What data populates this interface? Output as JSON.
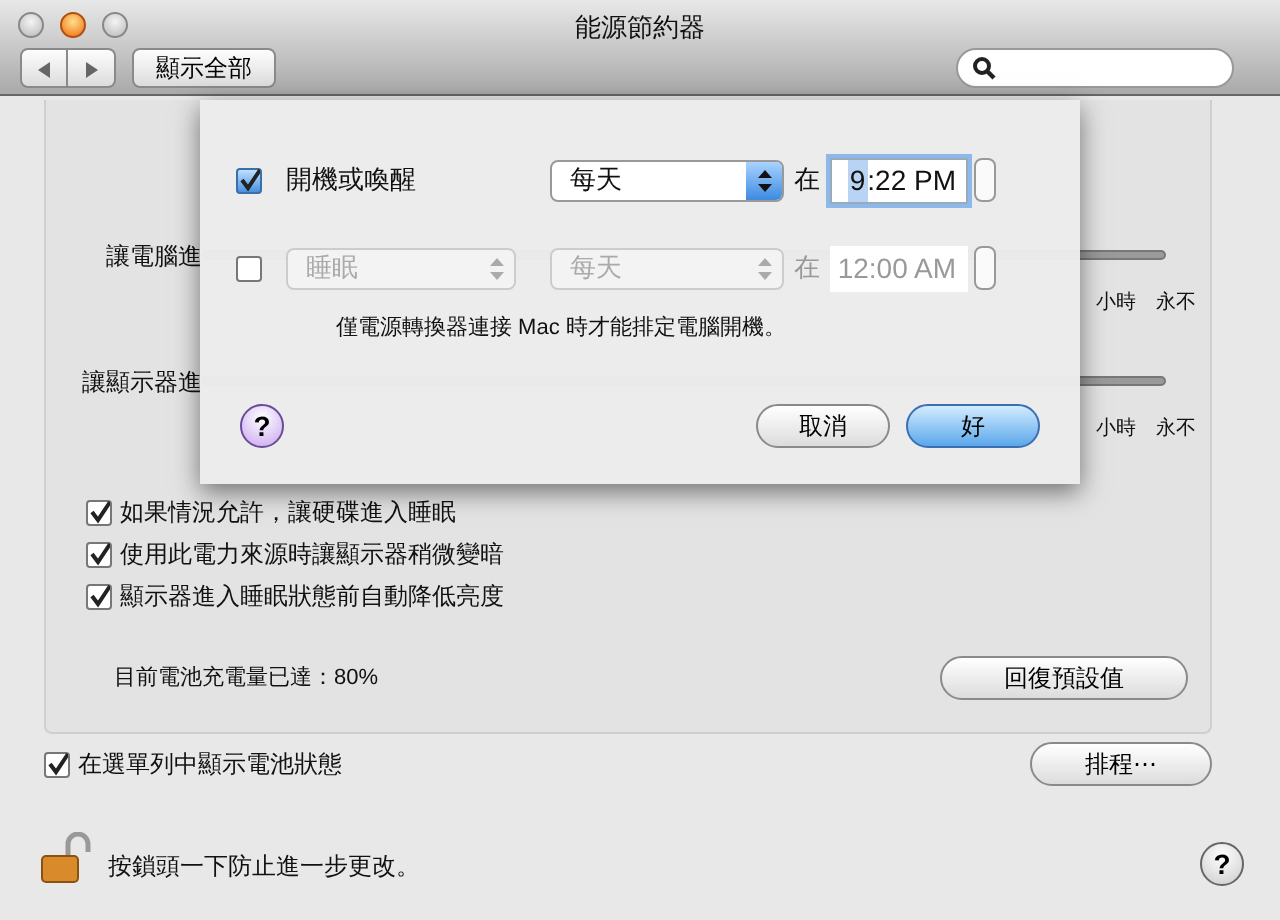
{
  "window": {
    "title": "能源節約器"
  },
  "toolbar": {
    "show_all_button": "顯示全部"
  },
  "settings": {
    "sliders": [
      {
        "label": "讓電腦進",
        "tick_labels": [
          "小時",
          "永不"
        ]
      },
      {
        "label": "讓顯示器進",
        "tick_labels": [
          "小時",
          "永不"
        ]
      }
    ],
    "options": [
      {
        "label": "如果情況允許，讓硬碟進入睡眠",
        "checked": true
      },
      {
        "label": "使用此電力來源時讓顯示器稍微變暗",
        "checked": true
      },
      {
        "label": "顯示器進入睡眠狀態前自動降低亮度",
        "checked": true
      }
    ],
    "battery_status": "目前電池充電量已達：80%",
    "restore_button": "回復預設值"
  },
  "menu_bar_option": {
    "label": "在選單列中顯示電池狀態",
    "checked": true
  },
  "schedule_button": "排程⋯",
  "lock": {
    "text": "按鎖頭一下防止進一步更改。"
  },
  "help_button": "?",
  "sheet": {
    "events": [
      {
        "kind": "label",
        "checked": true,
        "action": "開機或喚醒",
        "repeat": "每天",
        "at": "在",
        "time_segments": [
          {
            "text": "9",
            "selected": true
          },
          {
            "text": ":22 PM",
            "selected": false
          }
        ]
      },
      {
        "kind": "popup",
        "checked": false,
        "action": "睡眠",
        "repeat": "每天",
        "at": "在",
        "time_segments": [
          {
            "text": "12:00 AM",
            "selected": false
          }
        ]
      }
    ],
    "note": "僅電源轉換器連接 Mac 時才能排定電腦開機。",
    "help_button": "?",
    "buttons": [
      {
        "label": "取消",
        "default": false
      },
      {
        "label": "好",
        "default": true
      }
    ]
  }
}
